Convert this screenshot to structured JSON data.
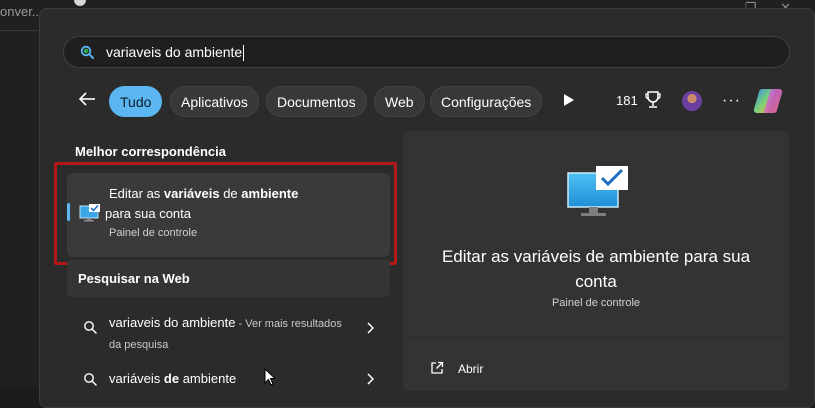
{
  "background": {
    "left_text": "onver..."
  },
  "search": {
    "value": "variaveis do ambiente",
    "icon": "search-icon"
  },
  "filters": {
    "tabs": [
      {
        "label": "Tudo",
        "active": true
      },
      {
        "label": "Aplicativos",
        "active": false
      },
      {
        "label": "Documentos",
        "active": false
      },
      {
        "label": "Web",
        "active": false
      },
      {
        "label": "Configurações",
        "active": false
      }
    ],
    "points": "181",
    "more": "···"
  },
  "best_match": {
    "section_title": "Melhor correspondência",
    "title_parts": [
      {
        "text": "Editar as ",
        "bold": false
      },
      {
        "text": "variáveis",
        "bold": true
      },
      {
        "text": " de ",
        "bold": false
      },
      {
        "text": "ambiente",
        "bold": true
      },
      {
        "text": " para sua conta",
        "bold": false
      }
    ],
    "subtitle": "Painel de controle"
  },
  "web_search": {
    "section_title": "Pesquisar na Web",
    "items": [
      {
        "text": "variaveis do ambiente",
        "suffix": " - Ver mais resultados da pesquisa"
      },
      {
        "text_parts": [
          {
            "text": "variáveis ",
            "bold": false
          },
          {
            "text": "de",
            "bold": true
          },
          {
            "text": " ambiente",
            "bold": false
          }
        ]
      }
    ]
  },
  "detail": {
    "title": "Editar as variáveis de ambiente para sua conta",
    "subtitle": "Painel de controle",
    "actions": [
      {
        "label": "Abrir",
        "icon": "open-external-icon"
      }
    ]
  },
  "colors": {
    "accent": "#5bb6f2",
    "highlight_border": "#b51818",
    "panel": "#2b2b2b"
  }
}
